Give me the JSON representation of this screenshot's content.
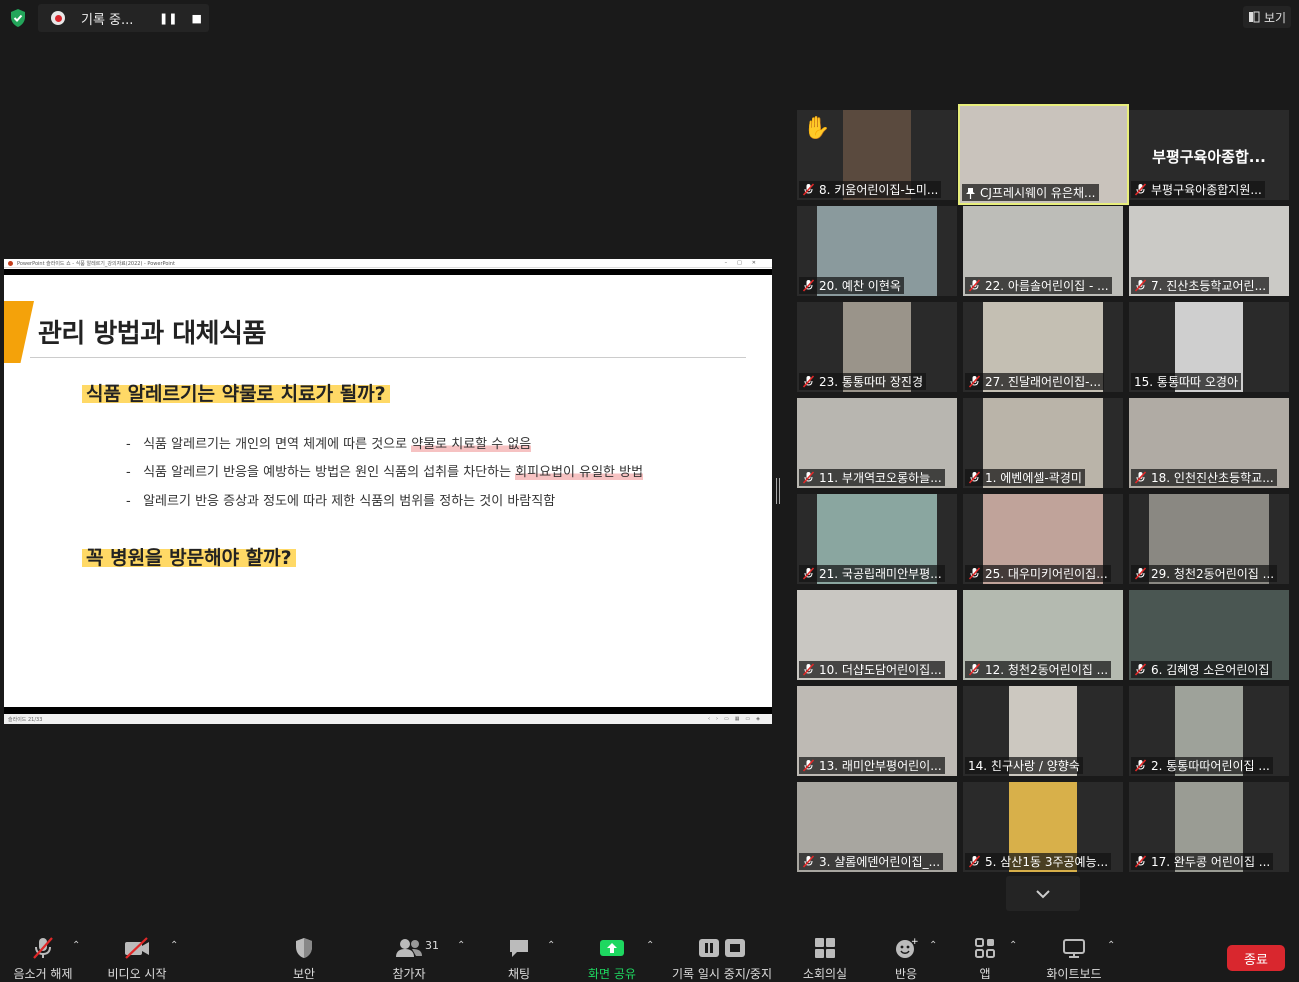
{
  "recording": {
    "status_text": "기록 중...",
    "pause_glyph": "❚❚",
    "stop_glyph": "■"
  },
  "view_button": {
    "label": "보기"
  },
  "shared_app": {
    "titlebar": "PowerPoint 슬라이드 쇼 - 식품 알레르기_강의자료(2022) - PowerPoint",
    "statusbar": "슬라이드 21/33",
    "slide": {
      "title": "관리 방법과 대체식품",
      "question_1": "식품 알레르기는 약물로 치료가 될까?",
      "bullets": [
        {
          "plain": "식품 알레르기는 개인의 면역 체계에 따른 것으로 ",
          "highlight": "약물로 치료할 수 없음"
        },
        {
          "plain": "식품 알레르기 반응을 예방하는 방법은 원인 식품의 섭취를 차단하는 ",
          "highlight": "회피요법이 유일한 방법"
        },
        {
          "plain": "알레르기 반응 증상과 정도에 따라 제한 식품의 범위를 정하는 것이 바람직함",
          "highlight": ""
        }
      ],
      "question_2": "꼭 병원을 방문해야 할까?"
    }
  },
  "participants": [
    {
      "label": "8. 키움어린이집-노미...",
      "muted": true,
      "hand": true
    },
    {
      "label": "CJ프레시웨이 유은채...",
      "pinned": true,
      "active": true
    },
    {
      "label": "부평구육아종합지원...",
      "muted": true,
      "name_only": "부평구육아종합..."
    },
    {
      "label": "20. 예찬 이현옥",
      "muted": true
    },
    {
      "label": "22. 아름솔어린이집 - ...",
      "muted": true
    },
    {
      "label": "7. 진산초등학교어린...",
      "muted": true
    },
    {
      "label": "23. 통통따따 장진경",
      "muted": true
    },
    {
      "label": "27. 진달래어린이집-...",
      "muted": true
    },
    {
      "label": "15. 통통따따 오경아",
      "muted": false
    },
    {
      "label": "11. 부개역코오롱하늘...",
      "muted": true
    },
    {
      "label": "1. 에벤에셀-곽경미",
      "muted": true
    },
    {
      "label": "18. 인천진산초등학교...",
      "muted": true
    },
    {
      "label": "21. 국공립래미안부평...",
      "muted": true
    },
    {
      "label": "25. 대우미키어린이집...",
      "muted": true
    },
    {
      "label": "29. 청천2동어린이집 ...",
      "muted": true
    },
    {
      "label": "10. 더샵도담어린이집...",
      "muted": true
    },
    {
      "label": "12. 청천2동어린이집 ...",
      "muted": true
    },
    {
      "label": "6. 김혜영 소은어린이집",
      "muted": true
    },
    {
      "label": "13. 래미안부평어린이...",
      "muted": true
    },
    {
      "label": "14. 친구사랑 / 양향숙",
      "muted": false
    },
    {
      "label": "2. 통통따따어린이집 ...",
      "muted": true
    },
    {
      "label": "3. 샬롬에덴어린이집_...",
      "muted": true
    },
    {
      "label": "5. 삼산1동 3주공예능...",
      "muted": true
    },
    {
      "label": "17. 완두콩 어린이집 ...",
      "muted": true
    }
  ],
  "toolbar": {
    "unmute": "음소거 해제",
    "start_video": "비디오 시작",
    "security": "보안",
    "participants": "참가자",
    "participants_count": "31",
    "chat": "채팅",
    "share_screen": "화면 공유",
    "pause_stop_recording": "기록 일시 중지/중지",
    "breakout_rooms": "소회의실",
    "reactions": "반응",
    "apps": "앱",
    "whiteboard": "화이트보드",
    "end": "종료"
  },
  "colors": {
    "accent_green": "#1ed760",
    "end_red": "#d9272e",
    "active_speaker": "#e8ee7c",
    "slide_highlight": "#ffd966"
  }
}
